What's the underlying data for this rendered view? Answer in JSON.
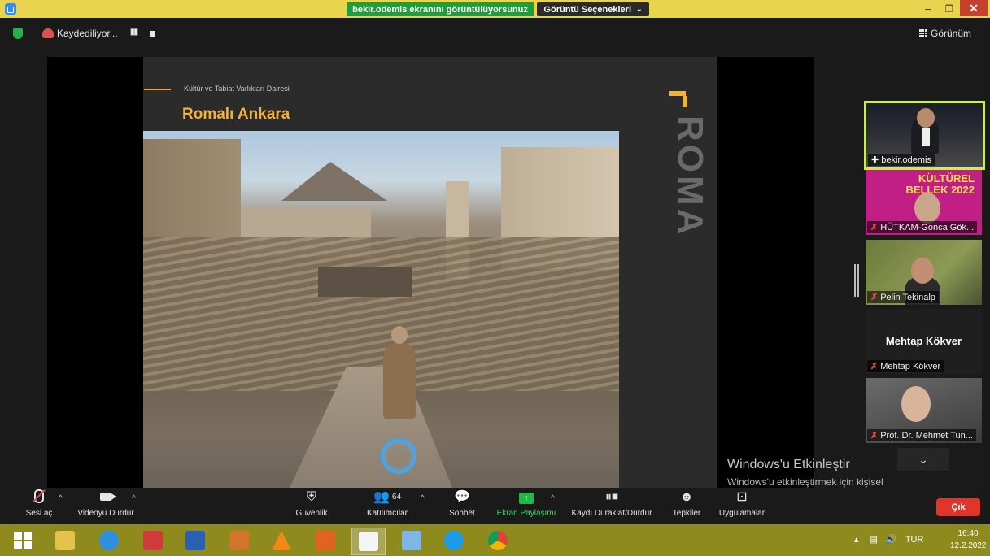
{
  "window": {
    "share_banner": "bekir.odemis ekranını görüntülüyorsunuz",
    "view_options": "Görüntü Seçenekleri",
    "view_options_chevron": "⌄",
    "minimize": "–",
    "maximize": "❐",
    "close": "✕"
  },
  "topbar": {
    "recording_label": "Kaydediliyor...",
    "pause_glyph": "▮▮",
    "view_label": "Görünüm"
  },
  "slide": {
    "department": "Kültür ve Tabiat Varlıkları Dairesi",
    "title": "Romalı Ankara",
    "vertical_text": "ROMA"
  },
  "watermark": {
    "title": "Windows'u Etkinleştir",
    "subtitle": "Windows'u etkinleştirmek için kişisel bilgisayar ayarlarına gidin."
  },
  "participants": [
    {
      "name": "bekir.odemis",
      "muted": false
    },
    {
      "name": "HÜTKAM-Gonca Gök...",
      "muted": true,
      "logo": "KÜLTÜREL BELLEK 2022"
    },
    {
      "name": "Pelin Tekinalp",
      "muted": true
    },
    {
      "name": "Mehtap Kökver",
      "muted": true,
      "display": "Mehtap Kökver"
    },
    {
      "name": "Prof. Dr. Mehmet Tun...",
      "muted": true
    }
  ],
  "strip_chevron": "⌄",
  "toolbar": {
    "unmute": "Sesi aç",
    "stop_video": "Videoyu Durdur",
    "security": "Güvenlik",
    "participants": "Katılımcılar",
    "participants_count": "64",
    "chat": "Sohbet",
    "share_screen": "Ekran Paylaşımı",
    "recording_control": "Kaydı Duraklat/Durdur",
    "reactions": "Tepkiler",
    "apps": "Uygulamalar",
    "leave": "Çık",
    "caret": "^"
  },
  "taskbar": {
    "tray_arrow": "▴",
    "language": "TUR",
    "time": "16:40",
    "date": "12.2.2022"
  },
  "colors": {
    "title_bar": "#e8d44d",
    "share_banner": "#1f9d3a",
    "accent_gold": "#f0b23a",
    "leave": "#e0352b",
    "taskbar": "#8f8a1e",
    "active_speaker": "#c8f04a"
  }
}
